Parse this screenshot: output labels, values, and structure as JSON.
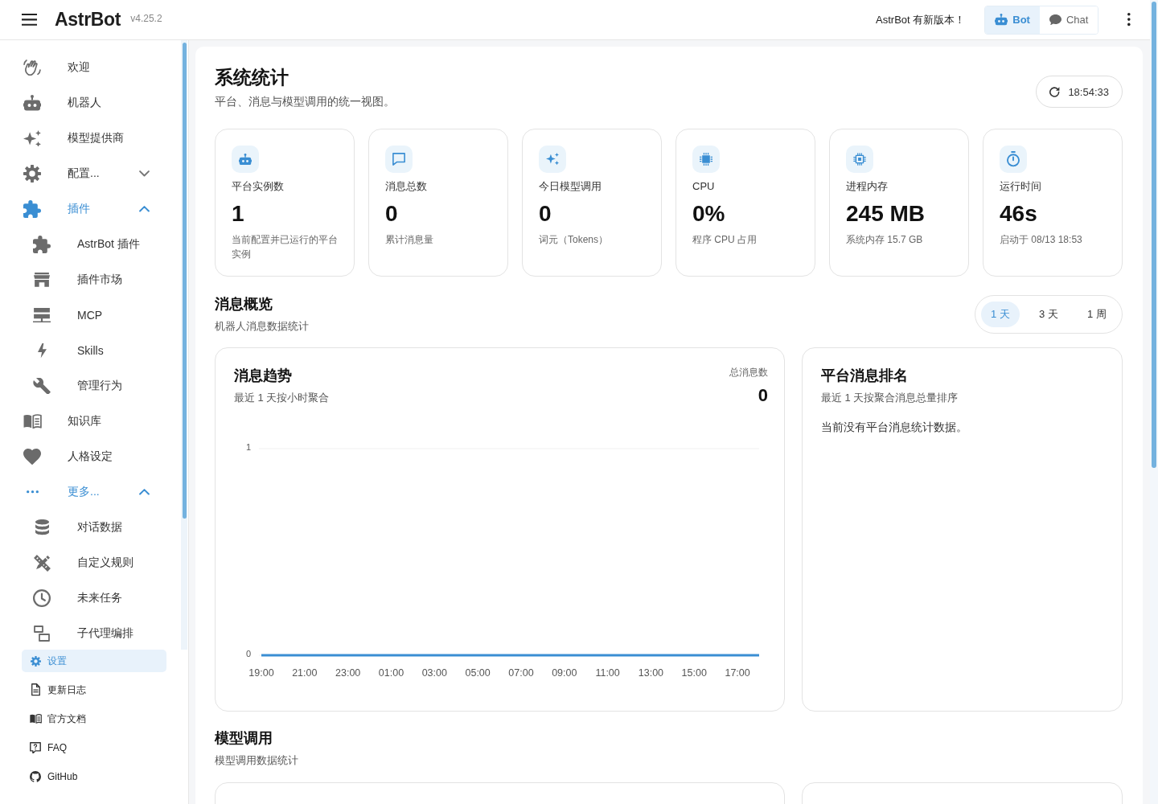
{
  "topbar": {
    "app_name": "AstrBot",
    "version": "v4.25.2",
    "update_notice": "AstrBot 有新版本！",
    "modes": [
      {
        "label": "Bot",
        "selected": true
      },
      {
        "label": "Chat",
        "selected": false
      }
    ]
  },
  "sidebar": {
    "items": [
      {
        "label": "欢迎",
        "selected": false
      },
      {
        "label": "机器人",
        "selected": false
      },
      {
        "label": "模型提供商",
        "selected": false
      },
      {
        "label": "配置...",
        "selected": false,
        "expanded": false
      },
      {
        "label": "插件",
        "selected": false,
        "expanded": true,
        "children": [
          {
            "label": "AstrBot 插件",
            "selected": false
          },
          {
            "label": "插件市场",
            "selected": false
          },
          {
            "label": "MCP",
            "selected": false
          },
          {
            "label": "Skills",
            "selected": false
          },
          {
            "label": "管理行为",
            "selected": false
          }
        ]
      },
      {
        "label": "知识库",
        "selected": false
      },
      {
        "label": "人格设定",
        "selected": false
      },
      {
        "label": "更多...",
        "selected": false,
        "expanded": true,
        "children": [
          {
            "label": "对话数据",
            "selected": false
          },
          {
            "label": "自定义规则",
            "selected": false
          },
          {
            "label": "未来任务",
            "selected": false
          },
          {
            "label": "子代理编排",
            "selected": false
          }
        ]
      }
    ],
    "footer_links": [
      {
        "label": "设置",
        "selected": true
      },
      {
        "label": "更新日志",
        "selected": false
      },
      {
        "label": "官方文档",
        "selected": false
      },
      {
        "label": "FAQ",
        "selected": false
      },
      {
        "label": "GitHub",
        "selected": false
      }
    ]
  },
  "header": {
    "title": "系统统计",
    "subtitle": "平台、消息与模型调用的统一视图。",
    "refresh_time": "18:54:33"
  },
  "stats": [
    {
      "label": "平台实例数",
      "value": "1",
      "caption": "当前配置并已运行的平台实例"
    },
    {
      "label": "消息总数",
      "value": "0",
      "caption": "累计消息量"
    },
    {
      "label": "今日模型调用",
      "value": "0",
      "caption": "词元（Tokens）"
    },
    {
      "label": "CPU",
      "value": "0%",
      "caption": "程序 CPU 占用"
    },
    {
      "label": "进程内存",
      "value": "245 MB",
      "caption": "系统内存 15.7 GB"
    },
    {
      "label": "运行时间",
      "value": "46s",
      "caption": "启动于 08/13 18:53"
    }
  ],
  "message_overview": {
    "title": "消息概览",
    "subtitle": "机器人消息数据统计",
    "ranges": [
      {
        "label": "1 天",
        "selected": true
      },
      {
        "label": "3 天",
        "selected": false
      },
      {
        "label": "1 周",
        "selected": false
      }
    ],
    "trend": {
      "title": "消息趋势",
      "subtitle": "最近 1 天按小时聚合",
      "total_label": "总消息数",
      "total_value": "0",
      "chart_data": {
        "type": "line",
        "categories": [
          "19:00",
          null,
          "21:00",
          null,
          "23:00",
          null,
          "01:00",
          null,
          "03:00",
          null,
          "05:00",
          null,
          "07:00",
          null,
          "09:00",
          null,
          "11:00",
          null,
          "13:00",
          null,
          "15:00",
          null,
          "17:00",
          null
        ],
        "ylim": [
          0,
          1
        ],
        "yticks": [
          0,
          1
        ],
        "series": [
          {
            "color": "#3a8ed3",
            "values": [
              0,
              0,
              0,
              0,
              0,
              0,
              0,
              0,
              0,
              0,
              0,
              0,
              0,
              0,
              0,
              0,
              0,
              0,
              0,
              0,
              0,
              0,
              0,
              0
            ]
          }
        ]
      }
    },
    "ranking": {
      "title": "平台消息排名",
      "subtitle": "最近 1 天按聚合消息总量排序",
      "empty_text": "当前没有平台消息统计数据。"
    }
  },
  "model_calls": {
    "title": "模型调用",
    "subtitle": "模型调用数据统计"
  }
}
